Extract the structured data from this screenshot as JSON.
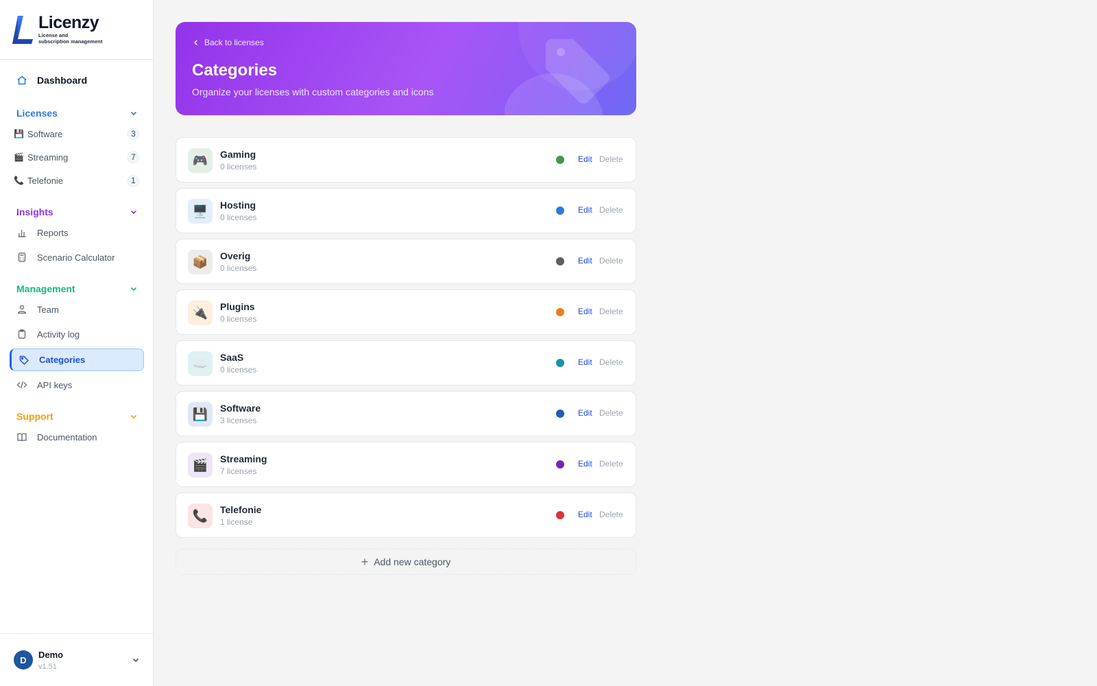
{
  "brand": {
    "name": "Licenzy",
    "tagline_1": "License and",
    "tagline_2": "subscription management"
  },
  "sidebar": {
    "dashboard": "Dashboard",
    "licenses": {
      "title": "Licenses",
      "color": "#2b7bd9",
      "items": [
        {
          "label": "Software",
          "count": "3",
          "icon": "floppy-disk-icon"
        },
        {
          "label": "Streaming",
          "count": "7",
          "icon": "clapper-icon"
        },
        {
          "label": "Telefonie",
          "count": "1",
          "icon": "phone-icon"
        }
      ]
    },
    "insights": {
      "title": "Insights",
      "color": "#9333ea",
      "items": [
        {
          "label": "Reports"
        },
        {
          "label": "Scenario Calculator"
        }
      ]
    },
    "management": {
      "title": "Management",
      "color": "#10b981",
      "items": [
        {
          "label": "Team"
        },
        {
          "label": "Activity log"
        },
        {
          "label": "Categories"
        },
        {
          "label": "API keys"
        }
      ]
    },
    "support": {
      "title": "Support",
      "color": "#f59e0b",
      "items": [
        {
          "label": "Documentation"
        }
      ]
    }
  },
  "user": {
    "initial": "D",
    "name": "Demo",
    "version": "v1.51"
  },
  "header": {
    "back": "Back to licenses",
    "title": "Categories",
    "subtitle": "Organize your licenses with custom categories and icons"
  },
  "actions": {
    "edit": "Edit",
    "delete": "Delete"
  },
  "categories": [
    {
      "name": "Gaming",
      "count": "0 licenses",
      "icon": "🎮",
      "color": "#3d9a4b",
      "bg": "#e6efe7"
    },
    {
      "name": "Hosting",
      "count": "0 licenses",
      "icon": "🖥️",
      "color": "#2b7bd9",
      "bg": "#e3eefb"
    },
    {
      "name": "Overig",
      "count": "0 licenses",
      "icon": "📦",
      "color": "#5f5f5f",
      "bg": "#ececec"
    },
    {
      "name": "Plugins",
      "count": "0 licenses",
      "icon": "🔌",
      "color": "#ee7d1e",
      "bg": "#fdeede"
    },
    {
      "name": "SaaS",
      "count": "0 licenses",
      "icon": "☁️",
      "color": "#1596a5",
      "bg": "#dff1f2"
    },
    {
      "name": "Software",
      "count": "3 licenses",
      "icon": "💾",
      "color": "#1f5fb0",
      "bg": "#e2e8f3"
    },
    {
      "name": "Streaming",
      "count": "7 licenses",
      "icon": "🎬",
      "color": "#7b24b6",
      "bg": "#eee5f6"
    },
    {
      "name": "Telefonie",
      "count": "1 license",
      "icon": "📞",
      "color": "#d83636",
      "bg": "#fbe4e4"
    }
  ],
  "add_button": "Add new category"
}
